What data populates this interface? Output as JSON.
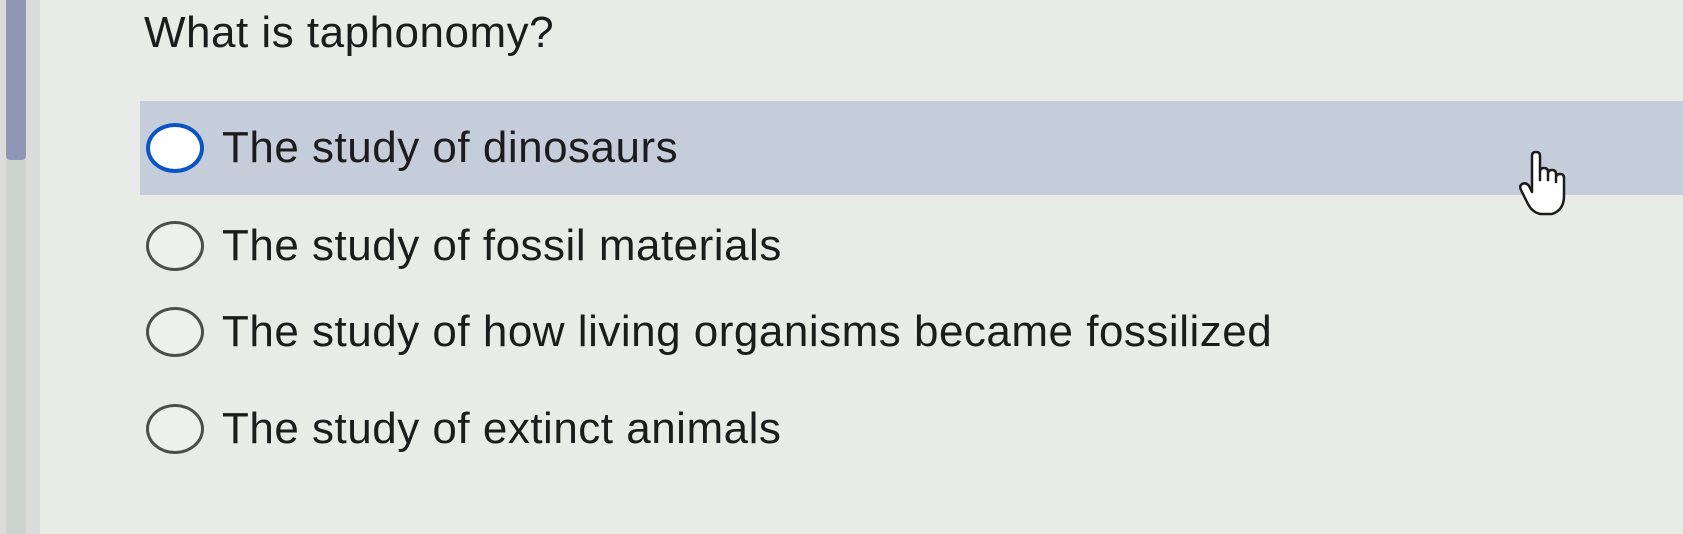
{
  "question": {
    "text": "What is taphonomy?"
  },
  "options": [
    {
      "label": "The study of dinosaurs",
      "selected": false,
      "hovered": true
    },
    {
      "label": "The study of fossil materials",
      "selected": false,
      "hovered": false
    },
    {
      "label": "The study of how living organisms became fossilized",
      "selected": false,
      "hovered": false
    },
    {
      "label": "The study of extinct animals",
      "selected": false,
      "hovered": false
    }
  ],
  "colors": {
    "hover_background": "#c5ccda",
    "focused_radio_border": "#0a55c6",
    "radio_border": "#4d4d4d"
  },
  "cursor": {
    "icon": "hand-pointer-icon"
  }
}
